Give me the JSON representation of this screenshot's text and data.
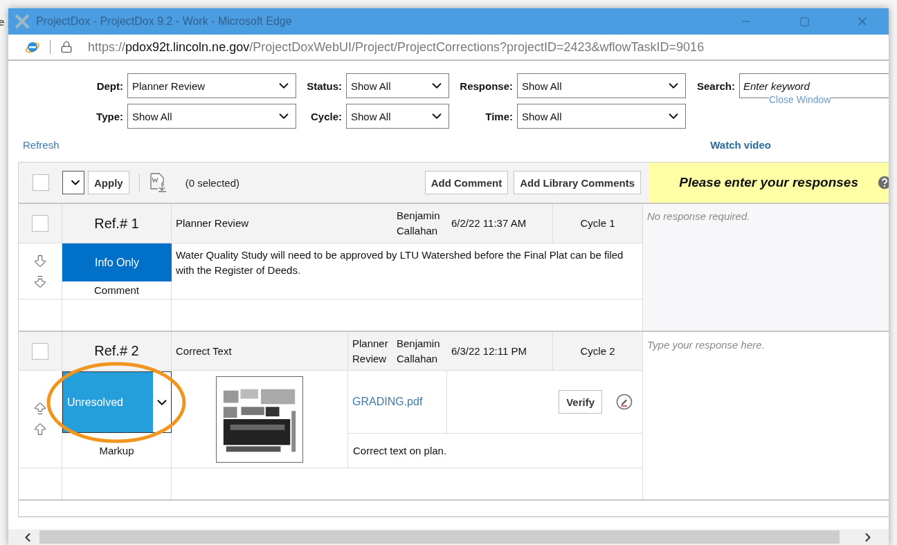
{
  "background_window": {
    "texts": [
      "e"
    ]
  },
  "window": {
    "title": "ProjectDox - ProjectDox 9.2 - Work - Microsoft Edge"
  },
  "address_bar": {
    "scheme": "https://",
    "host": "pdox92t.lincoln.ne.gov",
    "path": "/ProjectDoxWebUI/Project/ProjectCorrections?projectID=2423&wflowTaskID=9016"
  },
  "filters": [
    {
      "kind": "select",
      "label": "Dept:",
      "value": "Planner Review"
    },
    {
      "kind": "select",
      "label": "Status:",
      "value": "Show All"
    },
    {
      "kind": "select",
      "label": "Response:",
      "value": "Show All"
    },
    {
      "kind": "search",
      "label": "Search:",
      "placeholder": "Enter keyword"
    },
    {
      "kind": "select",
      "label": "Type:",
      "value": "Show All"
    },
    {
      "kind": "select",
      "label": "Cycle:",
      "value": "Show All"
    },
    {
      "kind": "select",
      "label": "Time:",
      "value": "Show All"
    }
  ],
  "close_link": "Close Window",
  "refresh_link": "Refresh",
  "video_link": "Watch video",
  "toolbar": {
    "select_all": false,
    "apply": "Apply",
    "selected_count": "(0 selected)",
    "buttons": [
      "Add Comment",
      "Add Library Comments"
    ],
    "response_banner": "Please enter your responses"
  },
  "records": [
    {
      "kind": "comment",
      "checked": false,
      "ref": "Ref.# 1",
      "status": {
        "kind": "badge",
        "label": "Info Only"
      },
      "type": "Comment",
      "category": "Planner Review",
      "author": "Benjamin Callahan",
      "date": "6/2/22 11:37 AM",
      "cycle": "Cycle 1",
      "text": "Water Quality Study will need to be approved by LTU Watershed before the Final Plat can be filed with the Register of Deeds.",
      "response": {
        "kind": "note",
        "text": "No response required."
      },
      "circled": false
    },
    {
      "kind": "markup",
      "checked": false,
      "ref": "Ref.# 2",
      "status": {
        "kind": "select",
        "label": "Unresolved"
      },
      "type": "Markup",
      "category": "Correct Text",
      "department": "Planner Review",
      "author": "Benjamin Callahan",
      "date": "6/3/22 12:11 PM",
      "cycle": "Cycle 2",
      "file": "GRADING.pdf",
      "action": "Verify",
      "text": "Correct text on plan.",
      "response": {
        "kind": "input",
        "placeholder": "Type your response here."
      },
      "circled": true
    }
  ]
}
